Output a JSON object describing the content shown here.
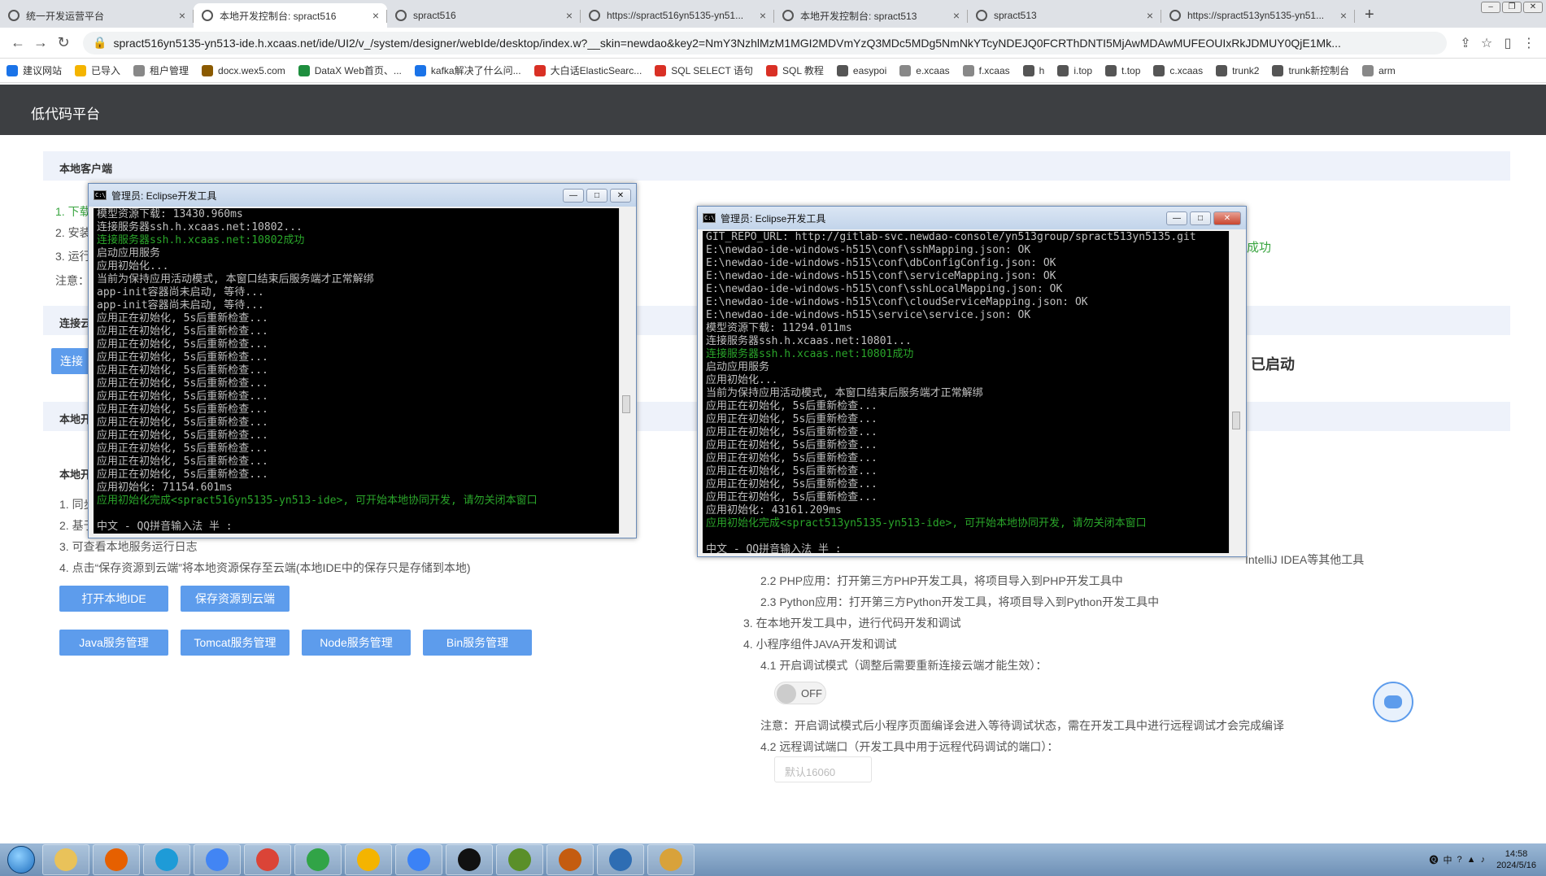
{
  "browser": {
    "tabs": [
      {
        "title": "统一开发运营平台",
        "active": false
      },
      {
        "title": "本地开发控制台: spract516",
        "active": true
      },
      {
        "title": "spract516",
        "active": false
      },
      {
        "title": "https://spract516yn5135-yn51...",
        "active": false
      },
      {
        "title": "本地开发控制台: spract513",
        "active": false
      },
      {
        "title": "spract513",
        "active": false
      },
      {
        "title": "https://spract513yn5135-yn51...",
        "active": false
      }
    ],
    "new_tab": "+",
    "url": "spract516yn5135-yn513-ide.h.xcaas.net/ide/UI2/v_/system/designer/webIde/desktop/index.w?__skin=newdao&key2=NmY3NzhlMzM1MGI2MDVmYzQ3MDc5MDg5NmNkYTcyNDEJQ0FCRThDNTI5MjAwMDAwMUFEOUIxRkJDMUY0QjE1Mk..."
  },
  "bookmarks": [
    {
      "label": "建议网站",
      "color": "#1a73e8"
    },
    {
      "label": "已导入",
      "color": "#f4b400"
    },
    {
      "label": "租户管理",
      "color": "#888888"
    },
    {
      "label": "docx.wex5.com",
      "color": "#8b5a00"
    },
    {
      "label": "DataX Web首页、...",
      "color": "#1e8e3e"
    },
    {
      "label": "kafka解决了什么问...",
      "color": "#1a73e8"
    },
    {
      "label": "大白话ElasticSearc...",
      "color": "#d93025"
    },
    {
      "label": "SQL SELECT 语句",
      "color": "#d93025"
    },
    {
      "label": "SQL 教程",
      "color": "#d93025"
    },
    {
      "label": "easypoi",
      "color": "#555555"
    },
    {
      "label": "e.xcaas",
      "color": "#888888"
    },
    {
      "label": "f.xcaas",
      "color": "#888888"
    },
    {
      "label": "h",
      "color": "#555555"
    },
    {
      "label": "i.top",
      "color": "#555555"
    },
    {
      "label": "t.top",
      "color": "#555555"
    },
    {
      "label": "c.xcaas",
      "color": "#555555"
    },
    {
      "label": "trunk2",
      "color": "#555555"
    },
    {
      "label": "trunk新控制台",
      "color": "#555555"
    },
    {
      "label": "arm",
      "color": "#888888"
    }
  ],
  "app": {
    "title": "低代码平台",
    "sections": {
      "local_client": "本地客户端",
      "connect_prefix": "连接云",
      "local_prefix": "本地开",
      "local_sub_prefix": "本地开"
    },
    "left_steps": {
      "s1": "1. 下载",
      "s2": "2. 安装",
      "s3": "3. 运行",
      "note": "注意：",
      "l1": "1. 同步",
      "l2": "2. 基于",
      "l3": "3. 可查看本地服务运行日志",
      "l4": "4. 点击“保存资源到云端”将本地资源保存至云端(本地IDE中的保存只是存储到本地)"
    },
    "connect_btn": "连接",
    "success_text": "成功",
    "started_text": "已启动",
    "buttons": {
      "open_ide": "打开本地IDE",
      "save_cloud": "保存资源到云端",
      "java": "Java服务管理",
      "tomcat": "Tomcat服务管理",
      "node": "Node服务管理",
      "bin": "Bin服务管理"
    },
    "right_steps": {
      "ij": "IntelliJ IDEA等其他工具",
      "php": "2.2 PHP应用：打开第三方PHP开发工具，将项目导入到PHP开发工具中",
      "py": "2.3 Python应用：打开第三方Python开发工具，将项目导入到Python开发工具中",
      "s3": "3. 在本地开发工具中，进行代码开发和调试",
      "s4": "4. 小程序组件JAVA开发和调试",
      "s41": "4.1 开启调试模式（调整后需要重新连接云端才能生效）：",
      "toggle": "OFF",
      "note": "注意：开启调试模式后小程序页面编译会进入等待调试状态，需在开发工具中进行远程调试才会完成编译",
      "s42": "4.2 远程调试端口（开发工具中用于远程代码调试的端口）：",
      "port_placeholder": "默认16060"
    }
  },
  "console1": {
    "title": "管理员: Eclipse开发工具",
    "lines": [
      {
        "t": "模型资源下载: 13430.960ms",
        "g": false
      },
      {
        "t": "连接服务器ssh.h.xcaas.net:10802...",
        "g": false
      },
      {
        "t": "连接服务器ssh.h.xcaas.net:10802成功",
        "g": true
      },
      {
        "t": "启动应用服务",
        "g": false
      },
      {
        "t": "应用初始化...",
        "g": false
      },
      {
        "t": "当前为保持应用活动模式, 本窗口结束后服务端才正常解绑",
        "g": false
      },
      {
        "t": "app-init容器尚未启动, 等待...",
        "g": false
      },
      {
        "t": "app-init容器尚未启动, 等待...",
        "g": false
      },
      {
        "t": "应用正在初始化, 5s后重新检查...",
        "g": false
      },
      {
        "t": "应用正在初始化, 5s后重新检查...",
        "g": false
      },
      {
        "t": "应用正在初始化, 5s后重新检查...",
        "g": false
      },
      {
        "t": "应用正在初始化, 5s后重新检查...",
        "g": false
      },
      {
        "t": "应用正在初始化, 5s后重新检查...",
        "g": false
      },
      {
        "t": "应用正在初始化, 5s后重新检查...",
        "g": false
      },
      {
        "t": "应用正在初始化, 5s后重新检查...",
        "g": false
      },
      {
        "t": "应用正在初始化, 5s后重新检查...",
        "g": false
      },
      {
        "t": "应用正在初始化, 5s后重新检查...",
        "g": false
      },
      {
        "t": "应用正在初始化, 5s后重新检查...",
        "g": false
      },
      {
        "t": "应用正在初始化, 5s后重新检查...",
        "g": false
      },
      {
        "t": "应用正在初始化, 5s后重新检查...",
        "g": false
      },
      {
        "t": "应用正在初始化, 5s后重新检查...",
        "g": false
      },
      {
        "t": "应用初始化: 71154.601ms",
        "g": false
      },
      {
        "t": "应用初始化完成<spract516yn5135-yn513-ide>, 可开始本地协同开发, 请勿关闭本窗口",
        "g": true
      },
      {
        "t": "",
        "g": false
      },
      {
        "t": "中文 - QQ拼音输入法 半 :",
        "g": false
      }
    ]
  },
  "console2": {
    "title": "管理员: Eclipse开发工具",
    "lines": [
      {
        "t": "GIT_REPO_URL: http://gitlab-svc.newdao-console/yn513group/spract513yn5135.git",
        "g": false
      },
      {
        "t": "E:\\newdao-ide-windows-h515\\conf\\sshMapping.json: OK",
        "g": false
      },
      {
        "t": "E:\\newdao-ide-windows-h515\\conf\\dbConfigConfig.json: OK",
        "g": false
      },
      {
        "t": "E:\\newdao-ide-windows-h515\\conf\\serviceMapping.json: OK",
        "g": false
      },
      {
        "t": "E:\\newdao-ide-windows-h515\\conf\\sshLocalMapping.json: OK",
        "g": false
      },
      {
        "t": "E:\\newdao-ide-windows-h515\\conf\\cloudServiceMapping.json: OK",
        "g": false
      },
      {
        "t": "E:\\newdao-ide-windows-h515\\service\\service.json: OK",
        "g": false
      },
      {
        "t": "模型资源下载: 11294.011ms",
        "g": false
      },
      {
        "t": "连接服务器ssh.h.xcaas.net:10801...",
        "g": false
      },
      {
        "t": "连接服务器ssh.h.xcaas.net:10801成功",
        "g": true
      },
      {
        "t": "启动应用服务",
        "g": false
      },
      {
        "t": "应用初始化...",
        "g": false
      },
      {
        "t": "当前为保持应用活动模式, 本窗口结束后服务端才正常解绑",
        "g": false
      },
      {
        "t": "应用正在初始化, 5s后重新检查...",
        "g": false
      },
      {
        "t": "应用正在初始化, 5s后重新检查...",
        "g": false
      },
      {
        "t": "应用正在初始化, 5s后重新检查...",
        "g": false
      },
      {
        "t": "应用正在初始化, 5s后重新检查...",
        "g": false
      },
      {
        "t": "应用正在初始化, 5s后重新检查...",
        "g": false
      },
      {
        "t": "应用正在初始化, 5s后重新检查...",
        "g": false
      },
      {
        "t": "应用正在初始化, 5s后重新检查...",
        "g": false
      },
      {
        "t": "应用正在初始化, 5s后重新检查...",
        "g": false
      },
      {
        "t": "应用初始化: 43161.209ms",
        "g": false
      },
      {
        "t": "应用初始化完成<spract513yn5135-yn513-ide>, 可开始本地协同开发, 请勿关闭本窗口",
        "g": true
      },
      {
        "t": "",
        "g": false
      },
      {
        "t": "中文 - QQ拼音输入法 半 :",
        "g": false
      }
    ]
  },
  "taskbar": {
    "apps": [
      {
        "name": "explorer-icon",
        "color": "#e9c25a"
      },
      {
        "name": "firefox-icon",
        "color": "#e66000"
      },
      {
        "name": "edge-icon",
        "color": "#1e9bd7"
      },
      {
        "name": "chromium-icon",
        "color": "#4285f4"
      },
      {
        "name": "chrome-icon",
        "color": "#db4437"
      },
      {
        "name": "ie-icon",
        "color": "#31a447"
      },
      {
        "name": "chrome-alt-icon",
        "color": "#f4b400"
      },
      {
        "name": "notes-icon",
        "color": "#3b82f6"
      },
      {
        "name": "cmd-icon",
        "color": "#111111"
      },
      {
        "name": "editor-icon",
        "color": "#5a8f29"
      },
      {
        "name": "ide-icon",
        "color": "#c45c10"
      },
      {
        "name": "window-icon",
        "color": "#2e6db3"
      },
      {
        "name": "paint-icon",
        "color": "#d8a23a"
      }
    ],
    "tray_lang": "中",
    "time": "14:58",
    "date": "2024/5/16"
  }
}
